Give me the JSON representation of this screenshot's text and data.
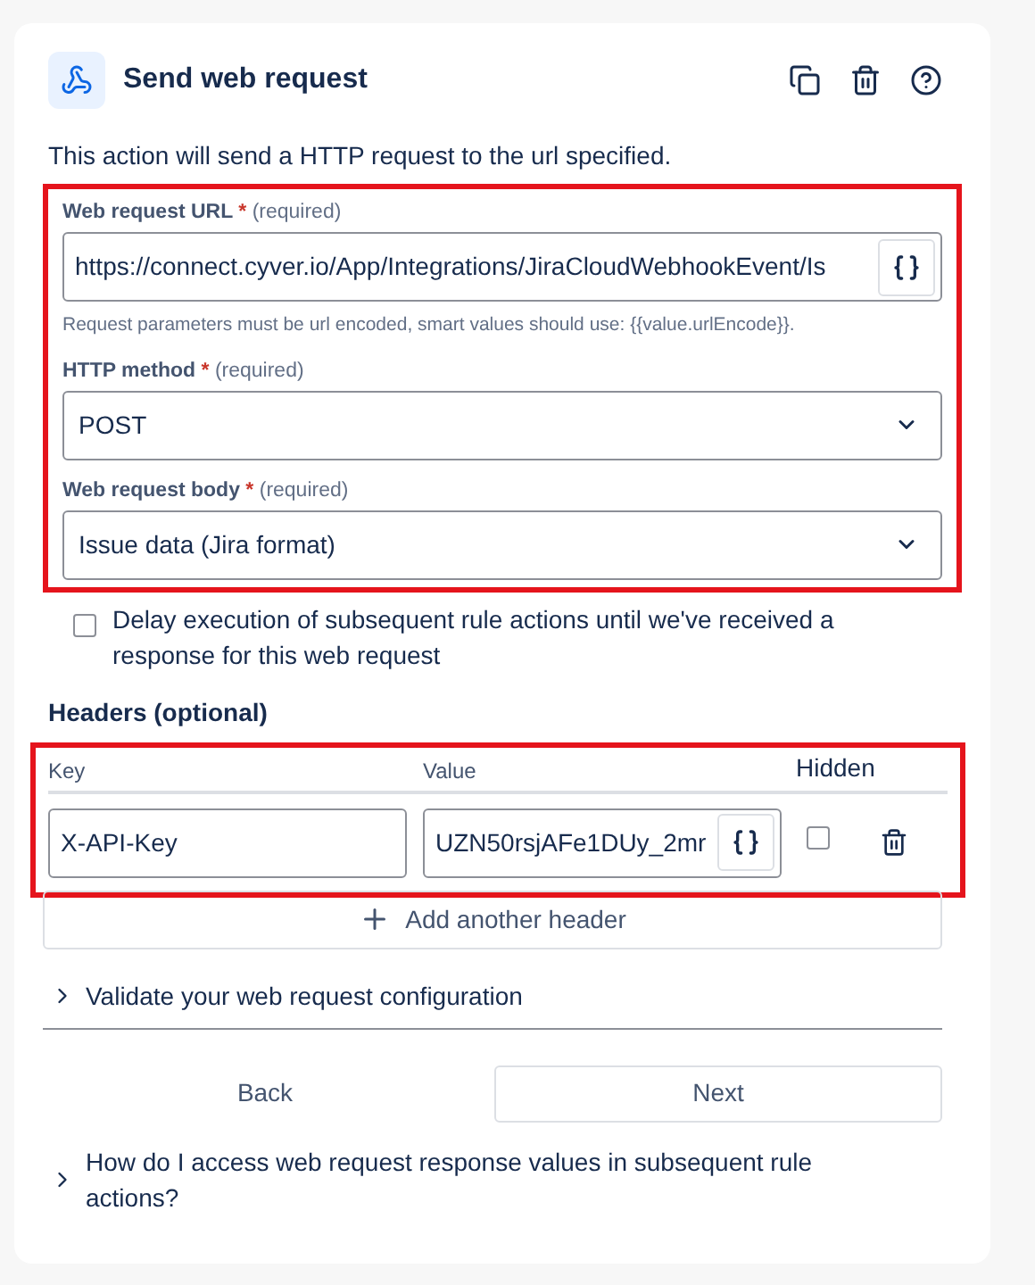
{
  "header": {
    "title": "Send web request"
  },
  "description": "This action will send a HTTP request to the url specified.",
  "request_section": {
    "highlighted": true,
    "url": {
      "label": "Web request URL",
      "required_mark": "*",
      "required_note": "(required)",
      "value": "https://connect.cyver.io/App/Integrations/JiraCloudWebhookEvent/Is",
      "hint": "Request parameters must be url encoded, smart values should use: {{value.urlEncode}}."
    },
    "method": {
      "label": "HTTP method",
      "required_mark": "*",
      "required_note": "(required)",
      "value": "POST"
    },
    "body": {
      "label": "Web request body",
      "required_mark": "*",
      "required_note": "(required)",
      "value": "Issue data (Jira format)"
    }
  },
  "delay_option": {
    "checked": false,
    "label": "Delay execution of subsequent rule actions until we've received a response for this web request"
  },
  "headers": {
    "title": "Headers (optional)",
    "highlighted": true,
    "columns": [
      "Key",
      "Value",
      "Hidden"
    ],
    "rows": [
      {
        "key": "X-API-Key",
        "value": "UZN50rsjAFe1DUy_2mr",
        "hidden": false
      }
    ],
    "add_button": "Add another header"
  },
  "validate": {
    "label": "Validate your web request configuration",
    "expanded": false
  },
  "buttons": {
    "back": "Back",
    "next": "Next"
  },
  "help": {
    "label": "How do I access web request response values in subsequent rule actions?",
    "expanded": false
  }
}
